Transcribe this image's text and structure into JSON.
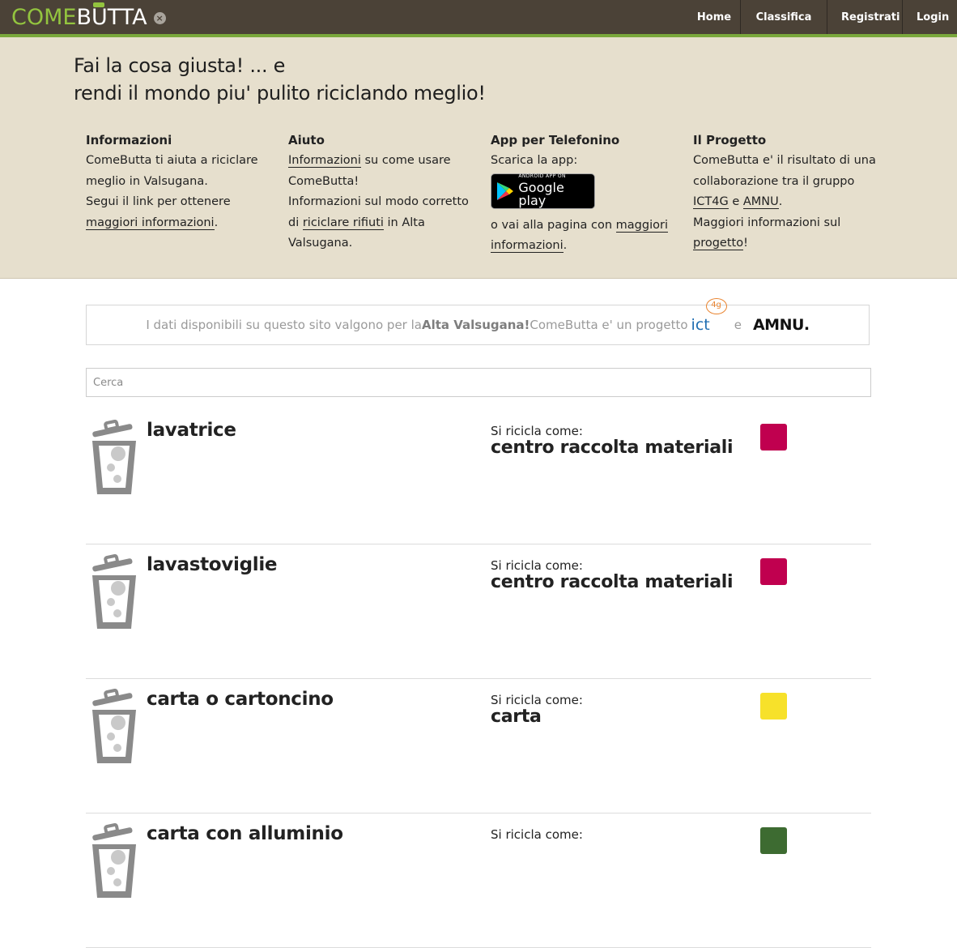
{
  "brand": {
    "logo_left": "COME",
    "logo_u": "U",
    "logo_b": "B",
    "logo_rest": "TTA"
  },
  "nav": {
    "home": "Home",
    "classifica": "Classifica",
    "registrati": "Registrati",
    "login": "Login"
  },
  "hero": {
    "title_line1": "Fai la cosa giusta! ... e",
    "title_line2": "rendi il mondo piu' pulito riciclando meglio!"
  },
  "columns": {
    "info": {
      "heading": "Informazioni",
      "line1": "ComeButta ti aiuta a riciclare meglio in Valsugana.",
      "line2_pre": "Segui il link per ottenere ",
      "link": "maggiori informazioni",
      "line2_post": "."
    },
    "aiuto": {
      "heading": "Aiuto",
      "link1": "Informazioni",
      "text1": " su come usare ComeButta!",
      "text2": "Informazioni sul modo corretto di ",
      "link2": "riciclare rifiuti",
      "text3": " in Alta Valsugana."
    },
    "app": {
      "heading": "App per Telefonino",
      "text1": "Scarica la app:",
      "badge_small": "ANDROID APP ON",
      "badge_big": "Google play",
      "text2": "o vai alla pagina con ",
      "link": "maggiori informazioni",
      "text3": "."
    },
    "progetto": {
      "heading": "Il Progetto",
      "text1": "ComeButta e' il risultato di una collaborazione tra il gruppo ",
      "link1": "ICT4G",
      "text2": " e ",
      "link2": "AMNU",
      "text3": ".",
      "text4": "Maggiori informazioni sul ",
      "link3": "progetto",
      "text5": "!"
    }
  },
  "banner": {
    "text1": "I dati disponibili su questo sito valgono per la ",
    "bold": "Alta Valsugana!",
    "text2": " ComeButta e' un progetto ",
    "ict": "ict",
    "ict_sup": "4g",
    "and": "e",
    "amnu": "AMNU",
    "amnu_dot": "."
  },
  "search": {
    "placeholder": "Cerca"
  },
  "results": [
    {
      "name": "lavatrice",
      "label": "Si ricicla come:",
      "category": "centro raccolta materiali",
      "color": "#c0004f"
    },
    {
      "name": "lavastoviglie",
      "label": "Si ricicla come:",
      "category": "centro raccolta materiali",
      "color": "#c0004f"
    },
    {
      "name": "carta o cartoncino",
      "label": "Si ricicla come:",
      "category": "carta",
      "color": "#f7e12a"
    },
    {
      "name": "carta con alluminio",
      "label": "Si ricicla come:",
      "category": "",
      "color": "#3d6b31"
    }
  ]
}
